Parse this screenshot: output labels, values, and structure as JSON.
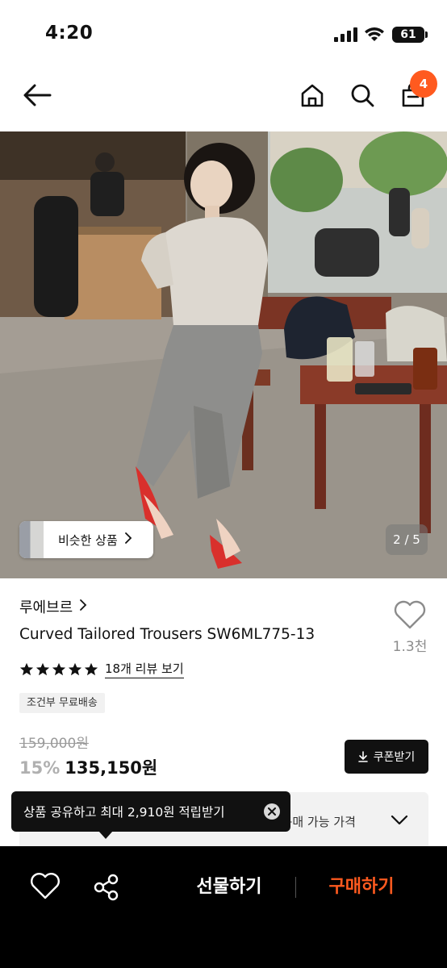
{
  "status_bar": {
    "time": "4:20",
    "battery": "61"
  },
  "nav": {
    "icons": [
      "back-arrow-icon",
      "home-icon",
      "search-icon",
      "cart-icon"
    ],
    "cart_badge": "4"
  },
  "gallery": {
    "similar_label": "비슷한 상품",
    "page_indicator": "2 / 5"
  },
  "product": {
    "brand": "루에브르",
    "title": "Curved Tailored Trousers SW6ML775-13",
    "like_count": "1.3천",
    "rating": 5,
    "review_link": "18개 리뷰 보기",
    "shipping_badge": "조건부 무료배송",
    "price_original": "159,000원",
    "discount": "15%",
    "price_final": "135,150원",
    "coupon_label": "쿠폰받기",
    "purchase_price_label": "의 구매 가능 가격"
  },
  "tooltip": {
    "text": "상품 공유하고 최대 2,910원 적립받기"
  },
  "bottom_bar": {
    "gift_label": "선물하기",
    "buy_label": "구매하기"
  },
  "colors": {
    "accent": "#ff5a1f",
    "bottom_bar_bg": "#000000"
  }
}
